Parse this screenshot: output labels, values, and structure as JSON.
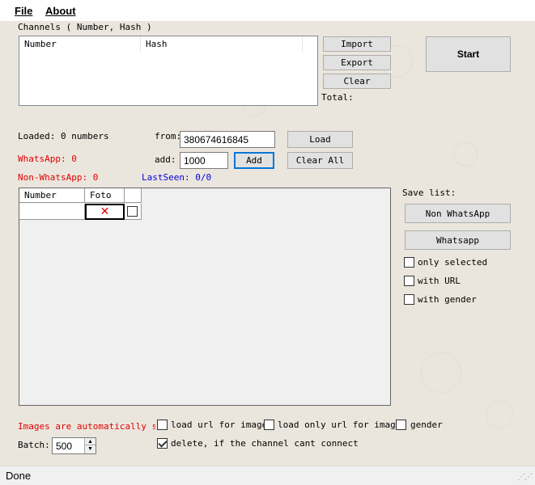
{
  "menu": {
    "file": "File",
    "about": "About"
  },
  "channels": {
    "title": "Channels ( Number, Hash )",
    "columns": [
      "Number",
      "Hash"
    ],
    "import_label": "Import",
    "export_label": "Export",
    "clear_label": "Clear",
    "total_label": "Total:"
  },
  "start_label": "Start",
  "loaded_text": "Loaded: 0 numbers",
  "whatsapp_text": "WhatsApp: 0",
  "nonwhatsapp_text": "Non-WhatsApp: 0",
  "lastseen_text": "LastSeen: 0/0",
  "from": {
    "label": "from:",
    "value": "380674616845"
  },
  "add": {
    "label": "add:",
    "value": "1000",
    "button": "Add"
  },
  "load_label": "Load",
  "clear_all_label": "Clear All",
  "grid": {
    "columns": [
      "Number",
      "Foto"
    ]
  },
  "save_list": {
    "title": "Save list:",
    "non_whatsapp": "Non WhatsApp",
    "whatsapp": "Whatsapp",
    "only_selected": "only selected",
    "with_url": "with URL",
    "with_gender": "with gender"
  },
  "images_note": "Images are automatically save",
  "options": {
    "load_url": "load url for images",
    "load_only_url": "load only url for images",
    "gender": "gender",
    "delete_label": "delete, if the channel cant connect"
  },
  "batch": {
    "label": "Batch:",
    "value": "500"
  },
  "status": "Done",
  "colors": {
    "accent": "#0078d7",
    "red_text": "#e00000",
    "blue_text": "#0000e0"
  }
}
